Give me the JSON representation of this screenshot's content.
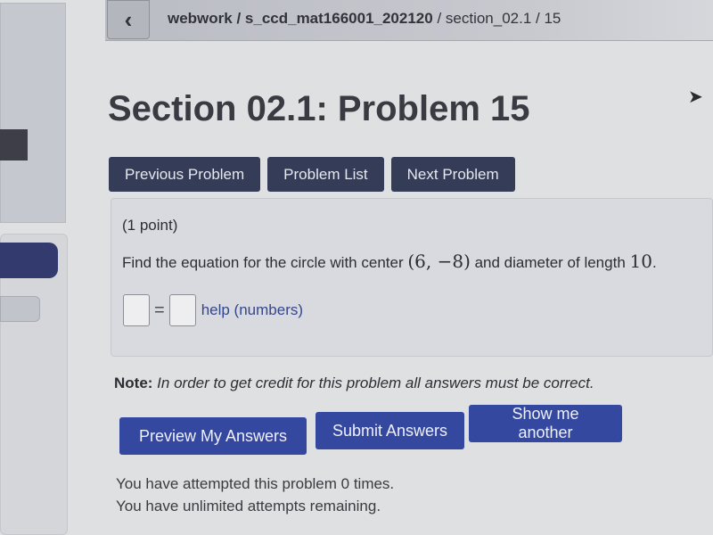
{
  "header": {
    "back_icon": "chevron-left-icon",
    "back_glyph": "‹",
    "breadcrumb": {
      "main": "webwork / s_ccd_mat166001_202120",
      "rest": " / section_02.1 / 15"
    }
  },
  "page_title": "Section 02.1: Problem 15",
  "nav": {
    "previous": "Previous Problem",
    "list": "Problem List",
    "next": "Next Problem"
  },
  "problem": {
    "points": "(1 point)",
    "question_prefix": "Find the equation for the circle with center ",
    "center": "(6, −8)",
    "question_middle": " and diameter of length ",
    "diameter": "10",
    "question_suffix": ".",
    "answer_left_value": "",
    "answer_right_value": "",
    "equals": "=",
    "help_link": "help (numbers)"
  },
  "note": {
    "label": "Note:",
    "text": " In order to get credit for this problem all answers must be correct."
  },
  "actions": {
    "preview": "Preview My Answers",
    "submit": "Submit Answers",
    "another": "Show me another"
  },
  "status": {
    "attempted": "You have attempted this problem 0 times.",
    "remaining": "You have unlimited attempts remaining."
  },
  "colors": {
    "nav_button": "#353c57",
    "action_button": "#3548a0",
    "help_link": "#34468c",
    "sidebar_active": "#333a6e"
  }
}
